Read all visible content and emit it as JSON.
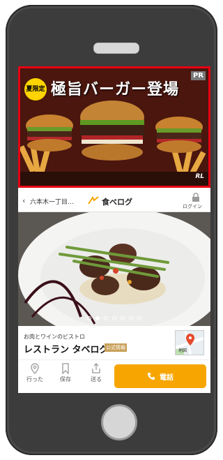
{
  "ad": {
    "badge": "夏限定",
    "headline": "極旨バーガー登場",
    "pr": "PR",
    "rl_mark": "RL"
  },
  "header": {
    "location": "六本木一丁目…",
    "logo_text": "食べログ",
    "login": "ログイン"
  },
  "gallery": {
    "dots": 7,
    "active_dot": 1
  },
  "restaurant": {
    "genre": "お肉とワインのビストロ",
    "name": "レストラン タベログ",
    "official_badge": "公式情報",
    "map_label": "地図"
  },
  "actions": {
    "went": "行った",
    "save": "保存",
    "send": "送る",
    "call": "電話"
  },
  "colors": {
    "highlight": "#e60012",
    "accent": "#f7a500",
    "frame": "#3c3c3c"
  },
  "icons": [
    "back-icon",
    "logo-icon",
    "lock-icon",
    "pin-icon",
    "bookmark-icon",
    "share-icon",
    "phone-icon",
    "map-icon"
  ]
}
